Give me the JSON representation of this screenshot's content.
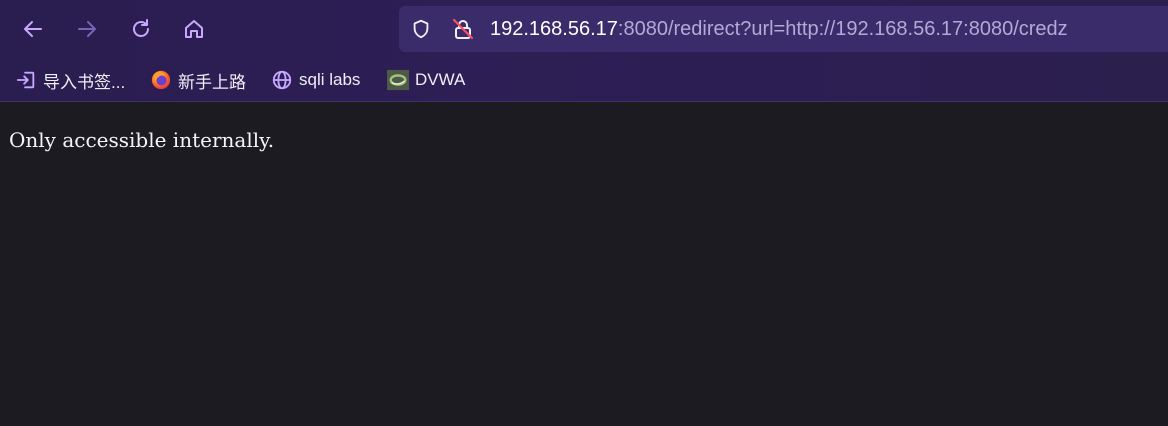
{
  "toolbar": {
    "back_icon": "arrow-left-icon",
    "forward_icon": "arrow-right-icon",
    "reload_icon": "reload-icon",
    "home_icon": "home-icon",
    "accent_color": "#c9a8ff",
    "disabled_color": "#7a63b8"
  },
  "urlbar": {
    "host": "192.168.56.17",
    "rest": ":8080/redirect?url=http://192.168.56.17:8080/credz",
    "shield_icon": "shield-icon",
    "insecure_lock_icon": "insecure-lock-icon"
  },
  "bookmarks": [
    {
      "label": "导入书签...",
      "icon": "import-icon"
    },
    {
      "label": "新手上路",
      "icon": "firefox-icon"
    },
    {
      "label": "sqli labs",
      "icon": "globe-icon"
    },
    {
      "label": "DVWA",
      "icon": "dvwa-logo-icon"
    }
  ],
  "page": {
    "message": "Only accessible internally."
  }
}
